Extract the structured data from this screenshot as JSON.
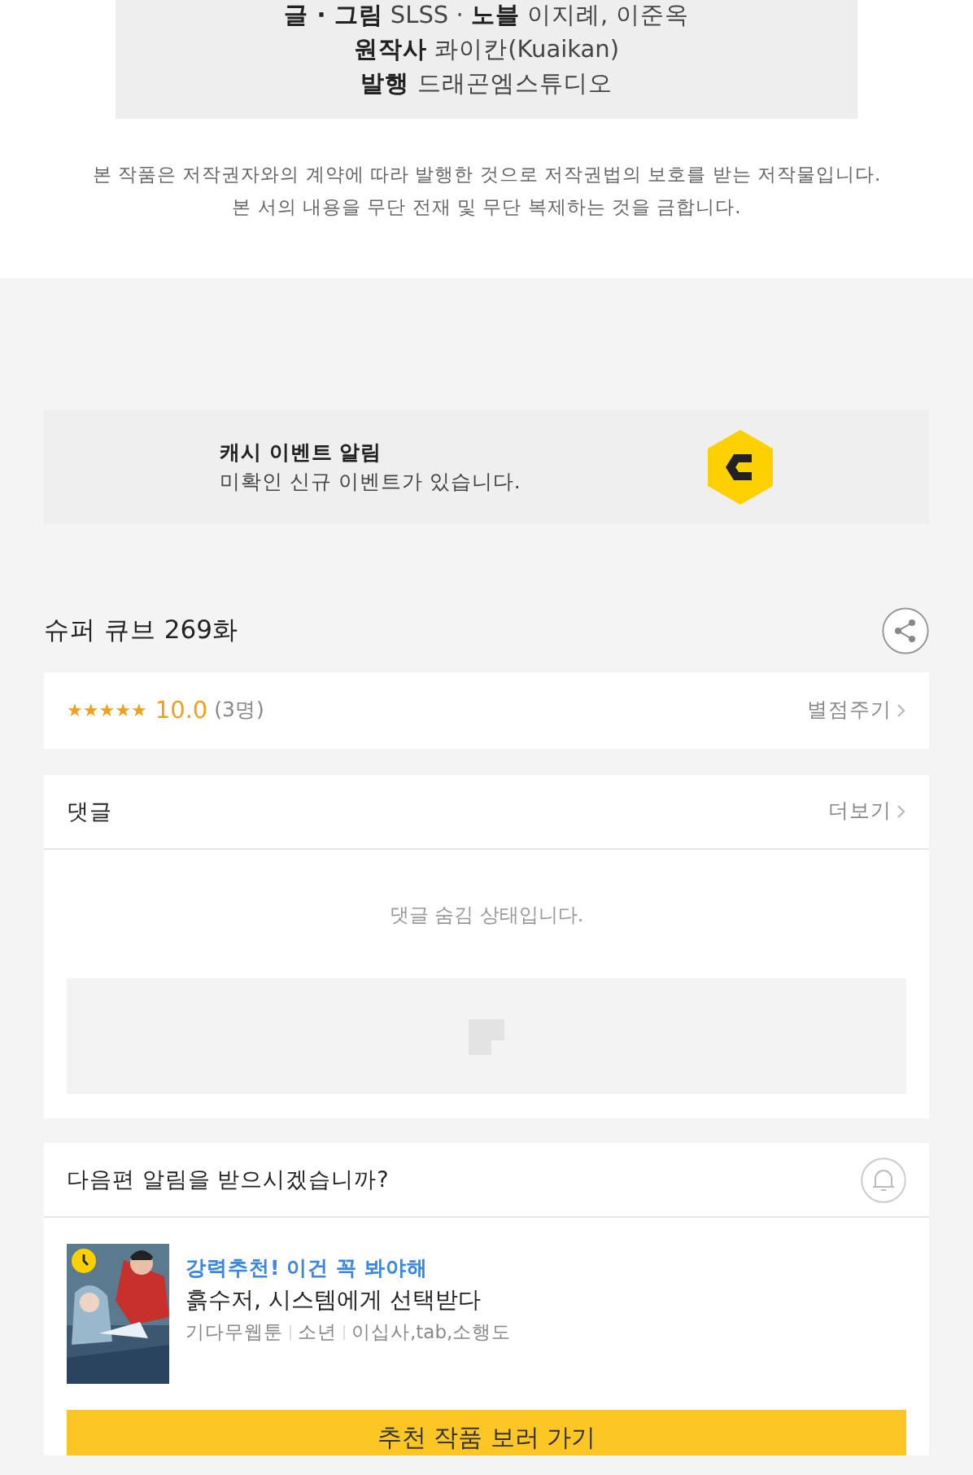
{
  "credits": {
    "lines": [
      "**글 · 그림** SLSS · **노블** 이지례, 이준옥",
      "**원작사** 콰이칸(Kuaikan)",
      "**발행** 드래곤엠스튜디오"
    ]
  },
  "copyright_notice": [
    "본 작품은 저작권자와의 계약에 따라 발행한 것으로 저작권법의 보호를 받는 저작물입니다.",
    "본 서의 내용을 무단 전재 및 무단 복제하는 것을 금합니다."
  ],
  "event_banner": {
    "title": "캐시 이벤트 알림",
    "message": "미확인 신규 이벤트가 있습니다."
  },
  "episode": {
    "title": "슈퍼 큐브 269화"
  },
  "rating": {
    "stars": 5,
    "score": "10.0",
    "count": "(3명)",
    "action": "별점주기"
  },
  "comments": {
    "title": "댓글",
    "more": "더보기",
    "status": "댓글 숨김 상태입니다."
  },
  "next_alert": {
    "question": "다음편 알림을 받으시겠습니까?",
    "recommendation": {
      "tagline": "강력추천! 이건 꼭 봐야해",
      "title": "흙수저, 시스템에게 선택받다",
      "tags": [
        "기다무웹툰",
        "소년",
        "이십사,tab,소행도"
      ],
      "waitfree": true
    },
    "button": "추천 작품 보러 가기"
  }
}
